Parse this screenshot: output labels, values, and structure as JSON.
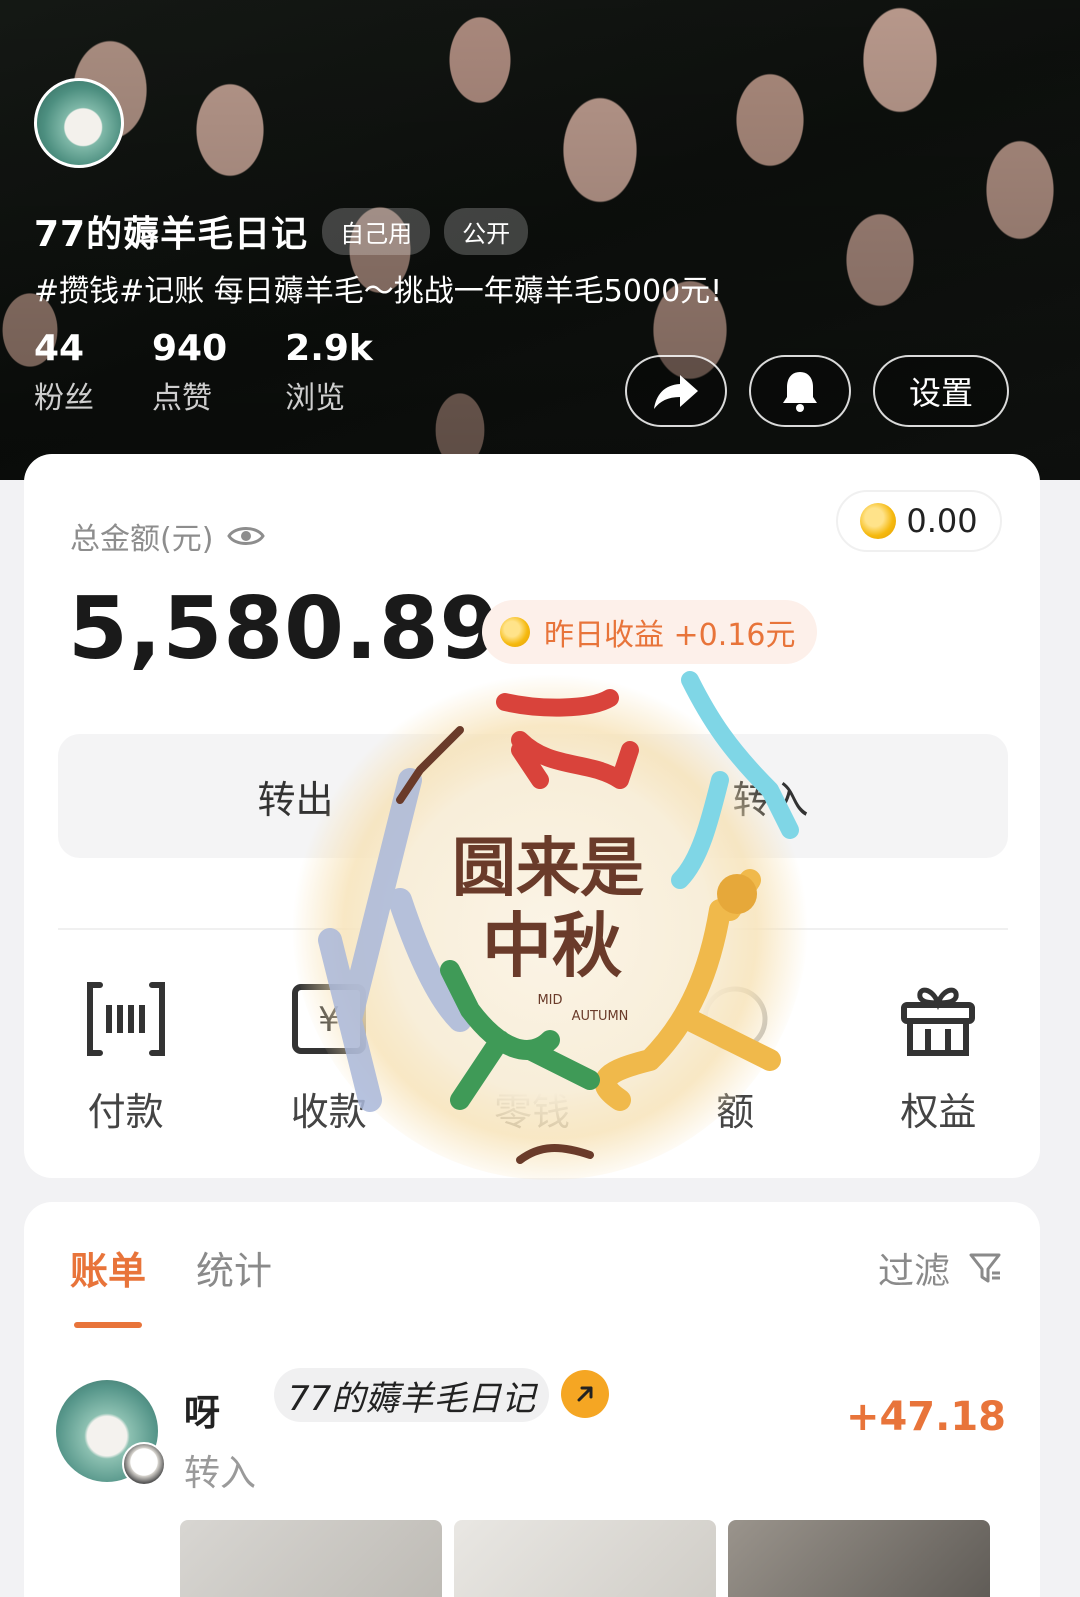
{
  "profile": {
    "name": "77的薅羊毛日记",
    "tags": [
      "自己用",
      "公开"
    ],
    "description": "#攒钱#记账  每日薅羊毛～挑战一年薅羊毛5000元!",
    "stats": [
      {
        "value": "44",
        "label": "粉丝"
      },
      {
        "value": "940",
        "label": "点赞"
      },
      {
        "value": "2.9k",
        "label": "浏览"
      }
    ],
    "buttons": {
      "share_icon": "share-arrow-icon",
      "bell_icon": "bell-icon",
      "settings_label": "设置"
    }
  },
  "wallet": {
    "total_label": "总金额(元)",
    "eye_icon": "eye-icon",
    "coin_balance": "0.00",
    "total_amount": "5,580.89",
    "yesterday_label": "昨日收益 +0.16元",
    "transfer_out": "转出",
    "transfer_in": "转入",
    "shortcuts": [
      {
        "icon": "payment-code-icon",
        "label": "付款"
      },
      {
        "icon": "receive-money-icon",
        "label": "收款"
      },
      {
        "icon": "wallet-icon",
        "label": "零钱"
      },
      {
        "icon": "balance-icon",
        "label": "额"
      },
      {
        "icon": "gift-box-icon",
        "label": "权益"
      }
    ]
  },
  "bill": {
    "tabs": [
      "账单",
      "统计"
    ],
    "active_tab": "账单",
    "filter_label": "过滤",
    "filter_icon": "filter-icon",
    "transactions": [
      {
        "name": "呀",
        "type": "转入",
        "group": "77的薅羊毛日记",
        "amount": "+47.18"
      }
    ]
  },
  "sticker": {
    "title_line1": "圆来是",
    "title_line2": "中秋",
    "en_line1": "MID",
    "en_line2": "AUTUMN"
  },
  "colors": {
    "accent": "#e8743a",
    "coin": "#f5b90f",
    "arrow_badge": "#f5a623"
  }
}
